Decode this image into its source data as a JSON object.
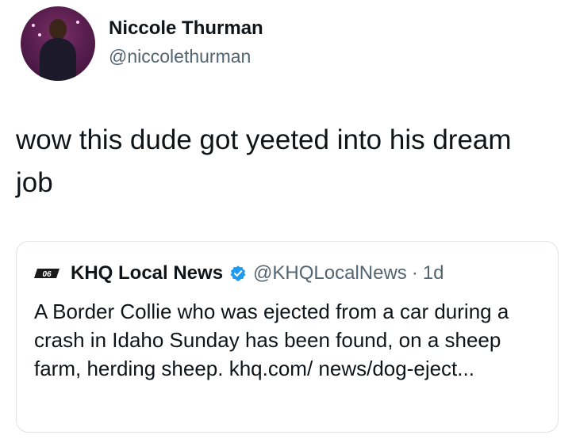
{
  "author": {
    "name": "Niccole Thurman",
    "handle": "@niccolethurman"
  },
  "tweet": {
    "text": "wow this dude got yeeted into his dream job"
  },
  "quoted_tweet": {
    "logo_text": "06",
    "name": "KHQ Local News",
    "verified": true,
    "handle": "@KHQLocalNews",
    "separator": "·",
    "time": "1d",
    "text": "A Border Collie who was ejected from a car during a crash in Idaho Sunday has been found, on a sheep farm, herding sheep. khq.com/ news/dog-eject..."
  },
  "colors": {
    "text": "#0f1419",
    "secondary": "#536471",
    "verified": "#1d9bf0",
    "border": "#dfe3e7"
  },
  "icons": {
    "verified": "verified-badge-icon",
    "logo": "khq-logo-icon"
  }
}
